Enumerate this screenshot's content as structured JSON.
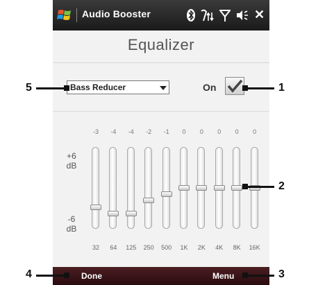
{
  "titlebar": {
    "app_title": "Audio Booster"
  },
  "main": {
    "title": "Equalizer",
    "preset": {
      "selected": "Bass Reducer"
    },
    "toggle": {
      "label": "On",
      "checked": true
    }
  },
  "equalizer": {
    "db_top": "+6\ndB",
    "db_bottom": "-6\ndB",
    "bands": [
      {
        "freq": "32",
        "value": "-3"
      },
      {
        "freq": "64",
        "value": "-4"
      },
      {
        "freq": "125",
        "value": "-4"
      },
      {
        "freq": "250",
        "value": "-2"
      },
      {
        "freq": "500",
        "value": "-1"
      },
      {
        "freq": "1K",
        "value": "0"
      },
      {
        "freq": "2K",
        "value": "0"
      },
      {
        "freq": "4K",
        "value": "0"
      },
      {
        "freq": "8K",
        "value": "0"
      },
      {
        "freq": "16K",
        "value": "0"
      }
    ]
  },
  "softkeys": {
    "left": "Done",
    "right": "Menu"
  },
  "callouts": [
    "1",
    "2",
    "3",
    "4",
    "5"
  ],
  "colors": {
    "titlebar": "#1a1a1a",
    "softbar": "#2a0c0f"
  }
}
